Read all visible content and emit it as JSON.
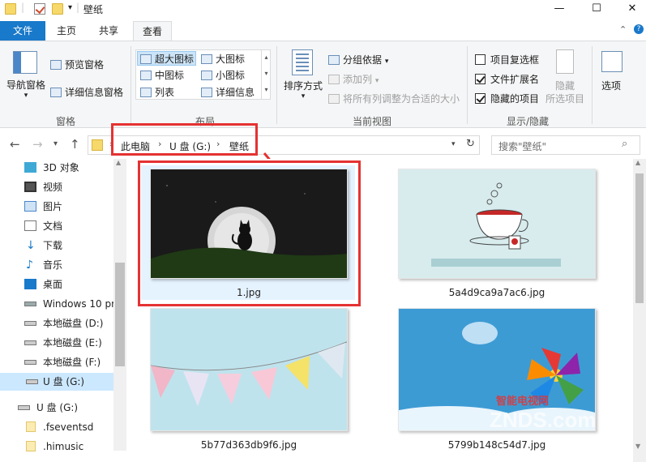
{
  "window": {
    "title": "壁纸",
    "minimize": "—",
    "maximize": "☐",
    "close": "✕"
  },
  "tabs": {
    "file": "文件",
    "home": "主页",
    "share": "共享",
    "view": "查看"
  },
  "ribbon": {
    "panes": {
      "nav_pane": "导航窗格",
      "preview_pane": "预览窗格",
      "details_pane": "详细信息窗格",
      "group": "窗格"
    },
    "layout": {
      "xl_icons": "超大图标",
      "large_icons": "大图标",
      "medium_icons": "中图标",
      "small_icons": "小图标",
      "list": "列表",
      "details": "详细信息",
      "group": "布局"
    },
    "current_view": {
      "sort_by": "排序方式",
      "group_by": "分组依据",
      "add_columns": "添加列",
      "fit_columns": "将所有列调整为合适的大小",
      "group": "当前视图"
    },
    "show_hide": {
      "item_checkboxes": "项目复选框",
      "item_checkboxes_checked": false,
      "file_extensions": "文件扩展名",
      "file_extensions_checked": true,
      "hidden_items": "隐藏的项目",
      "hidden_items_checked": true,
      "hide_selected": "隐藏",
      "hide_selected_sub": "所选项目",
      "group": "显示/隐藏"
    },
    "options": "选项"
  },
  "address": {
    "crumbs": [
      "此电脑",
      "U 盘 (G:)",
      "壁纸"
    ],
    "search_placeholder": "搜索\"壁纸\""
  },
  "sidebar": {
    "items": [
      {
        "label": "3D 对象",
        "icon": "3d-objects-icon"
      },
      {
        "label": "视频",
        "icon": "video-icon"
      },
      {
        "label": "图片",
        "icon": "pictures-icon"
      },
      {
        "label": "文档",
        "icon": "documents-icon"
      },
      {
        "label": "下载",
        "icon": "download-icon"
      },
      {
        "label": "音乐",
        "icon": "music-icon"
      },
      {
        "label": "桌面",
        "icon": "desktop-icon"
      },
      {
        "label": "Windows 10 pr",
        "icon": "windows-drive-icon"
      },
      {
        "label": "本地磁盘 (D:)",
        "icon": "drive-icon"
      },
      {
        "label": "本地磁盘 (E:)",
        "icon": "drive-icon"
      },
      {
        "label": "本地磁盘 (F:)",
        "icon": "drive-icon"
      },
      {
        "label": "U 盘 (G:)",
        "icon": "usb-drive-icon"
      },
      {
        "label": "U 盘 (G:)",
        "icon": "usb-drive-icon"
      },
      {
        "label": ".fseventsd",
        "icon": "folder-icon"
      },
      {
        "label": ".himusic",
        "icon": "folder-icon"
      }
    ]
  },
  "files": [
    {
      "name": "1.jpg"
    },
    {
      "name": "5a4d9ca9a7ac6.jpg"
    },
    {
      "name": "5b77d363db9f6.jpg"
    },
    {
      "name": "5799b148c54d7.jpg"
    }
  ],
  "watermark": {
    "cn": "智能电视网",
    "en": "ZNDS.com"
  },
  "colors": {
    "accent": "#1979ca",
    "highlight": "#e53232",
    "selection": "#cce8ff"
  }
}
